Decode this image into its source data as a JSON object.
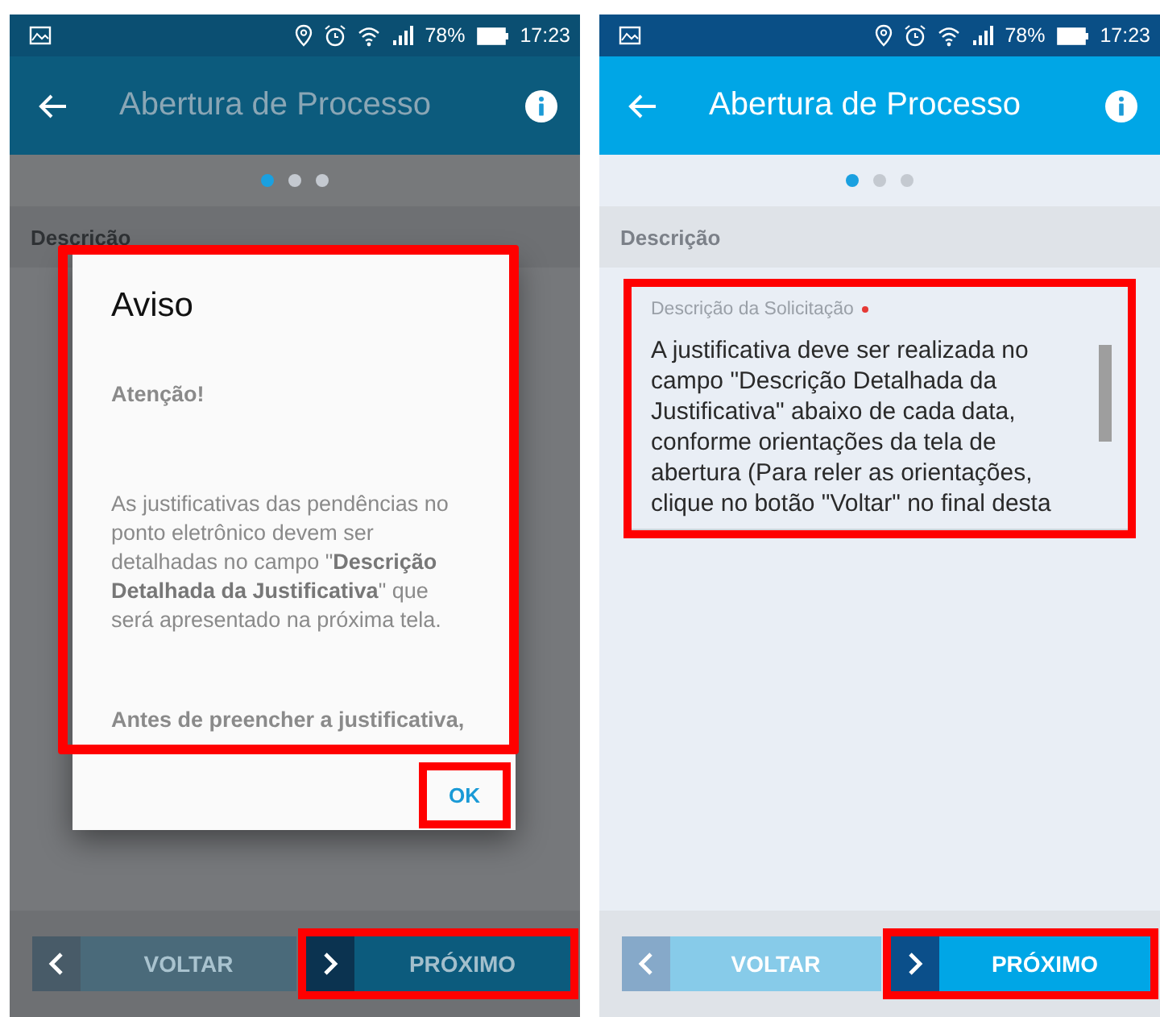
{
  "screens": [
    {
      "dimmed": true,
      "status_bar": {
        "battery": "78%",
        "time": "17:23"
      },
      "app_bar": {
        "title": "Abertura de Processo"
      },
      "page_dots": [
        {
          "selected": true
        },
        {
          "selected": false
        },
        {
          "selected": false
        }
      ],
      "section": "Descrição",
      "dialog": {
        "title": "Aviso",
        "highlighted": true,
        "paragraphs": [
          {
            "kind": "heading",
            "text": "Atenção!"
          },
          {
            "kind": "body",
            "text": "As justificativas das pendências no ponto eletrônico devem ser detalhadas no campo \"**Descrição Detalhada da Justificativa**\" que será apresentado na próxima tela."
          },
          {
            "kind": "heading",
            "text": "Antes de preencher a justificativa,"
          }
        ],
        "button": {
          "label": "OK",
          "highlighted": true
        }
      },
      "buttons": [
        {
          "kind": "back",
          "label": "VOLTAR",
          "disabled": true,
          "highlighted": false
        },
        {
          "kind": "next",
          "label": "PRÓXIMO",
          "disabled": false,
          "highlighted": true
        }
      ]
    },
    {
      "dimmed": false,
      "status_bar": {
        "battery": "78%",
        "time": "17:23"
      },
      "app_bar": {
        "title": "Abertura de Processo"
      },
      "page_dots": [
        {
          "selected": true
        },
        {
          "selected": false
        },
        {
          "selected": false
        }
      ],
      "section": "Descrição",
      "field": {
        "label": "Descrição da Solicitação",
        "required": true,
        "highlighted": true,
        "value": "A justificativa deve ser realizada no campo \"Descrição Detalhada da Justificativa\" abaixo de cada data, conforme orientações da tela de abertura (Para reler as orientações, clique no botão \"Voltar\" no final desta"
      },
      "buttons": [
        {
          "kind": "back",
          "label": "VOLTAR",
          "disabled": true,
          "highlighted": false
        },
        {
          "kind": "next",
          "label": "PRÓXIMO",
          "disabled": false,
          "highlighted": true
        }
      ]
    }
  ]
}
